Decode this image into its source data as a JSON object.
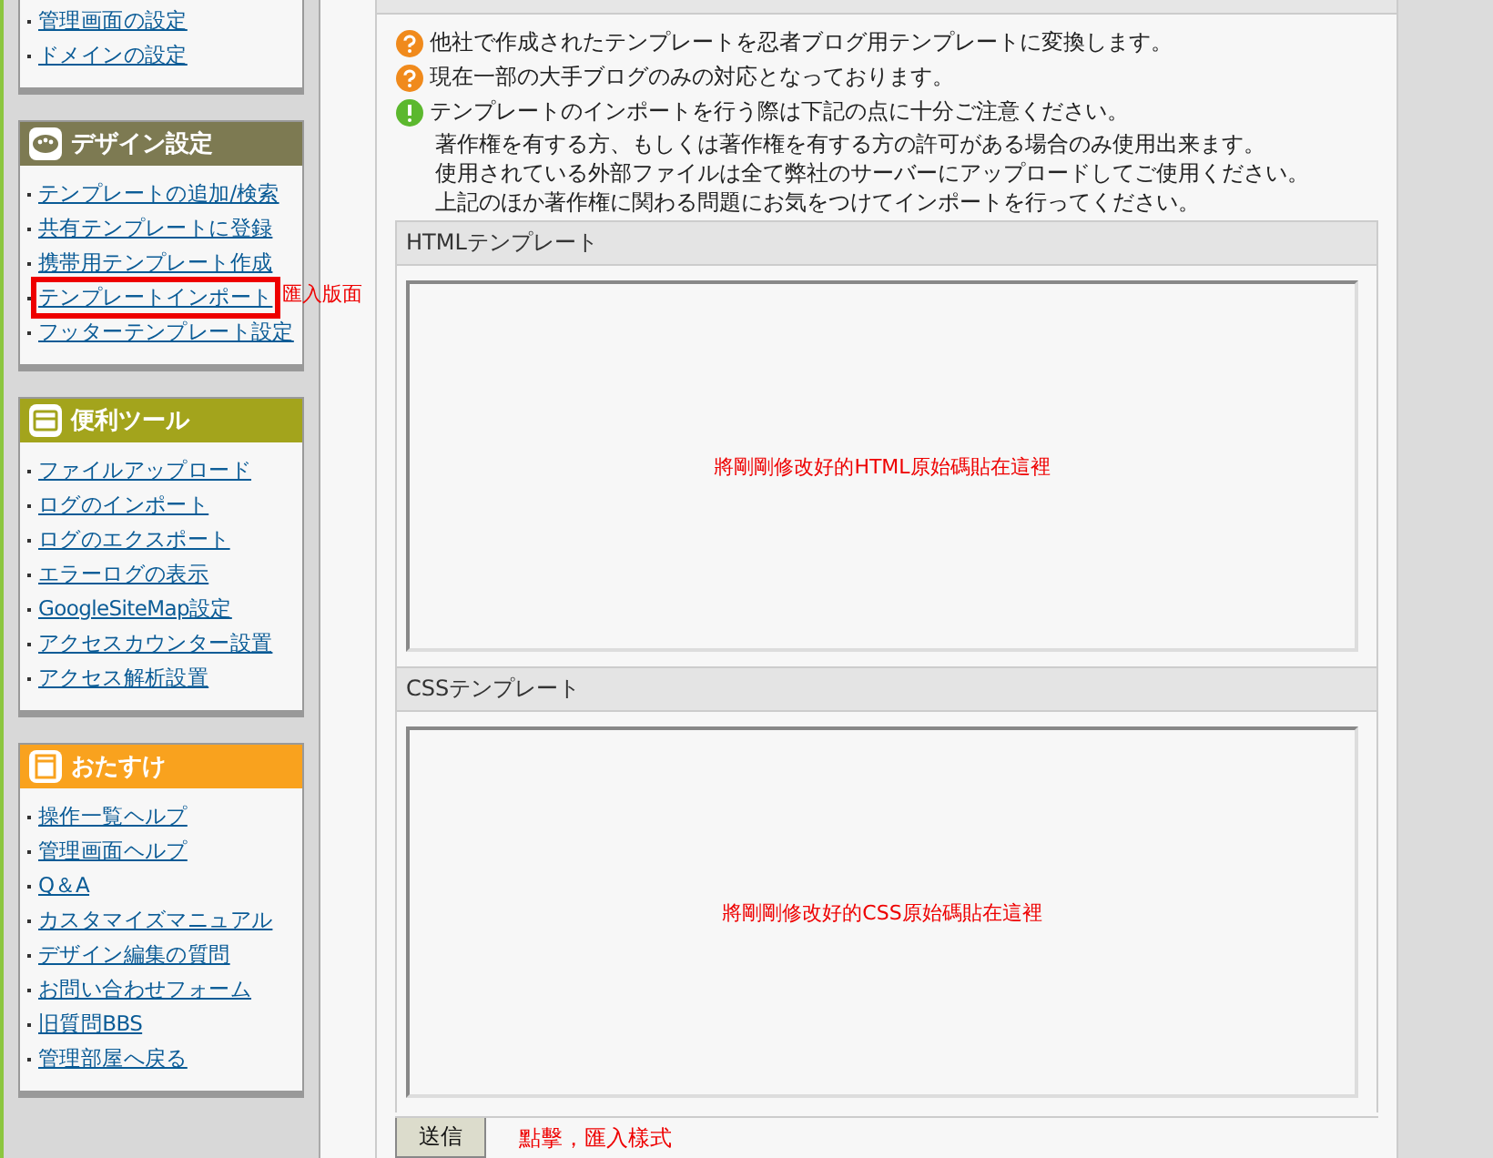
{
  "sidebar": [
    {
      "kind": "plain",
      "items": [
        {
          "label": "管理画面の設定",
          "highlighted": false
        },
        {
          "label": "ドメインの設定",
          "highlighted": false
        }
      ]
    },
    {
      "title": "デザイン設定",
      "kind": "design",
      "items": [
        {
          "label": "テンプレートの追加/検索",
          "highlighted": false
        },
        {
          "label": "共有テンプレートに登録",
          "highlighted": false
        },
        {
          "label": "携帯用テンプレート作成",
          "highlighted": false
        },
        {
          "label": "テンプレートインポート",
          "highlighted": true,
          "annotation": "匯入版面"
        },
        {
          "label": "フッターテンプレート設定",
          "highlighted": false
        }
      ]
    },
    {
      "title": "便利ツール",
      "kind": "tools",
      "items": [
        {
          "label": "ファイルアップロード",
          "highlighted": false
        },
        {
          "label": "ログのインポート",
          "highlighted": false
        },
        {
          "label": "ログのエクスポート",
          "highlighted": false
        },
        {
          "label": "エラーログの表示",
          "highlighted": false
        },
        {
          "label": "GoogleSiteMap設定",
          "highlighted": false
        },
        {
          "label": "アクセスカウンター設置",
          "highlighted": false
        },
        {
          "label": "アクセス解析設置",
          "highlighted": false
        }
      ]
    },
    {
      "title": "おたすけ",
      "kind": "help",
      "items": [
        {
          "label": "操作一覧ヘルプ",
          "highlighted": false
        },
        {
          "label": "管理画面ヘルプ",
          "highlighted": false
        },
        {
          "label": "Q＆A",
          "highlighted": false
        },
        {
          "label": "カスタマイズマニュアル",
          "highlighted": false
        },
        {
          "label": "デザイン編集の質問",
          "highlighted": false
        },
        {
          "label": "お問い合わせフォーム",
          "highlighted": false
        },
        {
          "label": "旧質問BBS",
          "highlighted": false
        },
        {
          "label": "管理部屋へ戻る",
          "highlighted": false
        }
      ]
    }
  ],
  "notices": [
    {
      "kind": "info",
      "text": "他社で作成されたテンプレートを忍者ブログ用テンプレートに変換します。"
    },
    {
      "kind": "info",
      "text": "現在一部の大手ブログのみの対応となっております。"
    },
    {
      "kind": "warning",
      "text": "テンプレートのインポートを行う際は下記の点に十分ご注意ください。"
    },
    {
      "kind": "detail",
      "text": "著作権を有する方、もしくは著作権を有する方の許可がある場合のみ使用出来ます。"
    },
    {
      "kind": "detail",
      "text": "使用されている外部ファイルは全て弊社のサーバーにアップロードしてご使用ください。"
    },
    {
      "kind": "detail",
      "text": "上記のほか著作権に関わる問題にお気をつけてインポートを行ってください。"
    }
  ],
  "fields": [
    {
      "label": "HTMLテンプレート",
      "annotation": "將剛剛修改好的HTML原始碼貼在這裡"
    },
    {
      "label": "CSSテンプレート",
      "annotation": "將剛剛修改好的CSS原始碼貼在這裡"
    }
  ],
  "submit": {
    "label": "送信",
    "annotation": "點擊，匯入樣式"
  }
}
